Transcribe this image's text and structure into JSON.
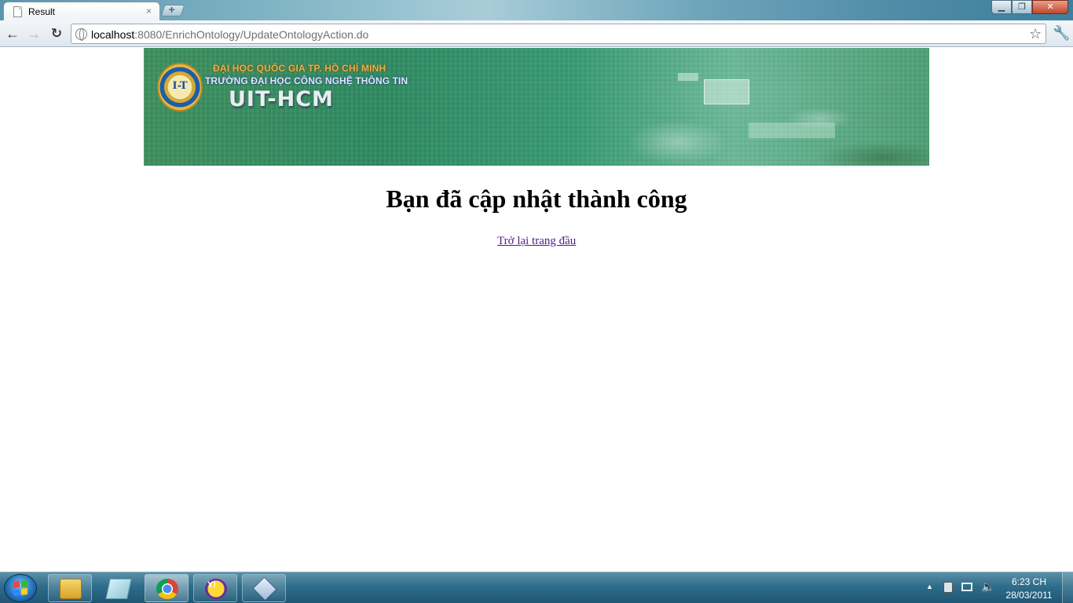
{
  "browser": {
    "tab_title": "Result",
    "tab_close": "×",
    "new_tab": "+",
    "url_host": "localhost",
    "url_rest": ":8080/EnrichOntology/UpdateOntologyAction.do",
    "icons": [
      "page-icon",
      "close-icon",
      "back-arrow-icon",
      "forward-arrow-icon",
      "reload-icon",
      "globe-icon",
      "star-icon",
      "wrench-icon"
    ]
  },
  "window_controls": {
    "minimize": "▁",
    "maximize": "❐",
    "close": "✕"
  },
  "banner": {
    "logo_text": "I-T",
    "line1": "ĐẠI HỌC QUỐC GIA TP. HỒ CHÍ MINH",
    "line2": "TRƯỜNG ĐẠI HỌC CÔNG NGHỆ THÔNG TIN",
    "line3": "UIT-HCM"
  },
  "page": {
    "heading": "Bạn đã cập nhật thành công",
    "home_link": "Trở lại trang đầu"
  },
  "taskbar": {
    "yahoo_label": "Y!",
    "items": [
      "windows-explorer-icon",
      "sticky-notes-icon",
      "chrome-icon",
      "yahoo-messenger-icon",
      "virtualbox-icon"
    ],
    "tray_arrow": "▲",
    "volume": "🔈",
    "clock_time": "6:23 CH",
    "clock_date": "28/03/2011"
  },
  "colors": {
    "link_visited": "#551a8b",
    "banner_green": "#2f8a62",
    "taskbar_blue": "#2f6d8b"
  }
}
